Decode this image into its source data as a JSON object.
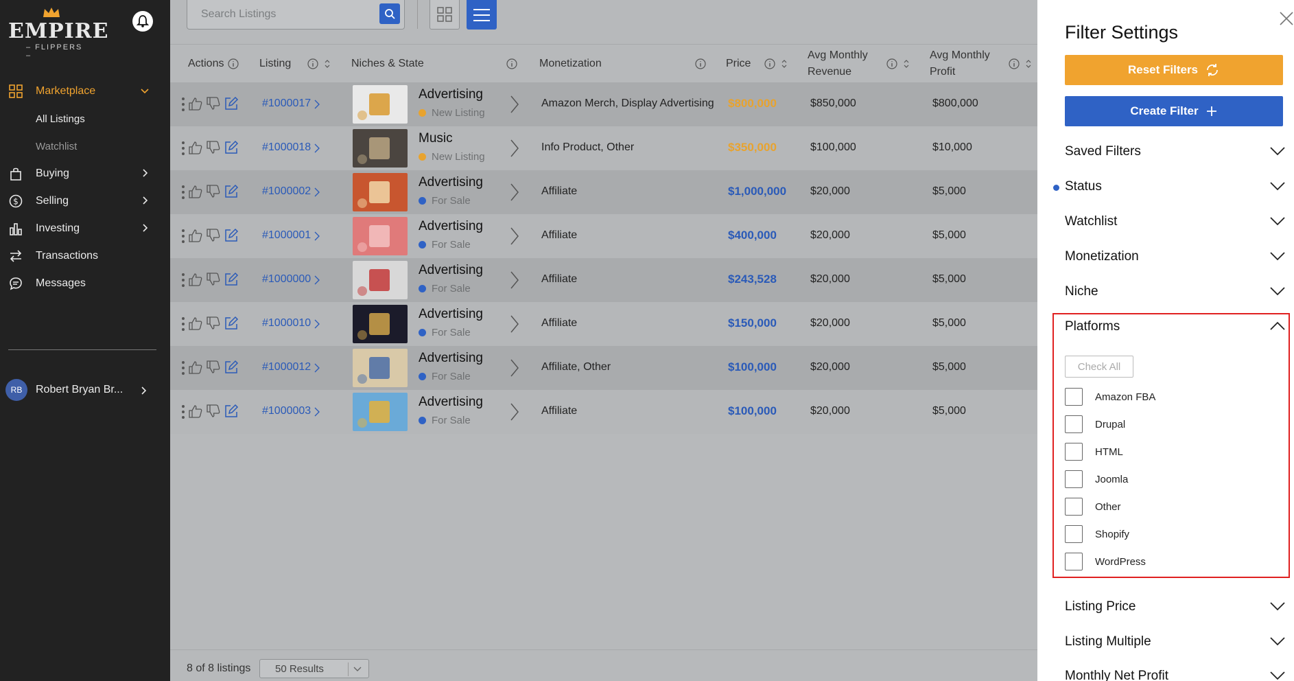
{
  "sidebar": {
    "logo": {
      "word1": "EMPIRE",
      "word2": "– FLIPPERS –"
    },
    "items": [
      {
        "label": "Marketplace",
        "icon": "grid-icon",
        "active": true
      },
      {
        "label": "All Listings",
        "sub": true
      },
      {
        "label": "Watchlist",
        "sub": true
      },
      {
        "label": "Buying",
        "icon": "bag-icon"
      },
      {
        "label": "Selling",
        "icon": "dollar-icon"
      },
      {
        "label": "Investing",
        "icon": "bar-chart-icon"
      },
      {
        "label": "Transactions",
        "icon": "swap-icon"
      },
      {
        "label": "Messages",
        "icon": "chat-icon"
      }
    ],
    "user": {
      "initials": "RB",
      "name": "Robert Bryan Br..."
    }
  },
  "search": {
    "placeholder": "Search Listings"
  },
  "table": {
    "headers": {
      "actions": "Actions",
      "listing": "Listing",
      "niches": "Niches & State",
      "monetization": "Monetization",
      "price": "Price",
      "revenue_l1": "Avg Monthly",
      "revenue_l2": "Revenue",
      "profit_l1": "Avg Monthly",
      "profit_l2": "Profit"
    },
    "rows": [
      {
        "id": "#1000017",
        "niche": "Advertising",
        "state": "New Listing",
        "state_color": "#e8a32e",
        "monetization": "Amazon Merch, Display Advertising",
        "price": "$800,000",
        "price_color": "#e8a32e",
        "revenue": "$850,000",
        "profit": "$800,000"
      },
      {
        "id": "#1000018",
        "niche": "Music",
        "state": "New Listing",
        "state_color": "#e8a32e",
        "monetization": "Info Product, Other",
        "price": "$350,000",
        "price_color": "#e8a32e",
        "revenue": "$100,000",
        "profit": "$10,000"
      },
      {
        "id": "#1000002",
        "niche": "Advertising",
        "state": "For Sale",
        "state_color": "#2f62c5",
        "monetization": "Affiliate",
        "price": "$1,000,000",
        "price_color": "#2a5ab8",
        "revenue": "$20,000",
        "profit": "$5,000"
      },
      {
        "id": "#1000001",
        "niche": "Advertising",
        "state": "For Sale",
        "state_color": "#2f62c5",
        "monetization": "Affiliate",
        "price": "$400,000",
        "price_color": "#2a5ab8",
        "revenue": "$20,000",
        "profit": "$5,000"
      },
      {
        "id": "#1000000",
        "niche": "Advertising",
        "state": "For Sale",
        "state_color": "#2f62c5",
        "monetization": "Affiliate",
        "price": "$243,528",
        "price_color": "#2a5ab8",
        "revenue": "$20,000",
        "profit": "$5,000"
      },
      {
        "id": "#1000010",
        "niche": "Advertising",
        "state": "For Sale",
        "state_color": "#2f62c5",
        "monetization": "Affiliate",
        "price": "$150,000",
        "price_color": "#2a5ab8",
        "revenue": "$20,000",
        "profit": "$5,000"
      },
      {
        "id": "#1000012",
        "niche": "Advertising",
        "state": "For Sale",
        "state_color": "#2f62c5",
        "monetization": "Affiliate, Other",
        "price": "$100,000",
        "price_color": "#2a5ab8",
        "revenue": "$20,000",
        "profit": "$5,000"
      },
      {
        "id": "#1000003",
        "niche": "Advertising",
        "state": "For Sale",
        "state_color": "#2f62c5",
        "monetization": "Affiliate",
        "price": "$100,000",
        "price_color": "#2a5ab8",
        "revenue": "$20,000",
        "profit": "$5,000"
      }
    ]
  },
  "footer": {
    "count": "8 of 8 listings",
    "per_page": "50 Results"
  },
  "filter": {
    "title": "Filter Settings",
    "reset_label": "Reset Filters",
    "create_label": "Create Filter",
    "sections_top": [
      "Saved Filters",
      "Status",
      "Watchlist",
      "Monetization",
      "Niche"
    ],
    "platforms_title": "Platforms",
    "check_all": "Check All",
    "platforms": [
      "Amazon FBA",
      "Drupal",
      "HTML",
      "Joomla",
      "Other",
      "Shopify",
      "WordPress"
    ],
    "sections_bottom": [
      "Listing Price",
      "Listing Multiple",
      "Monthly Net Profit"
    ]
  },
  "colors": {
    "accent_orange": "#f0a32f",
    "accent_blue": "#2f62c5",
    "sidebar_bg": "#222222",
    "highlight_red": "#e02020"
  }
}
